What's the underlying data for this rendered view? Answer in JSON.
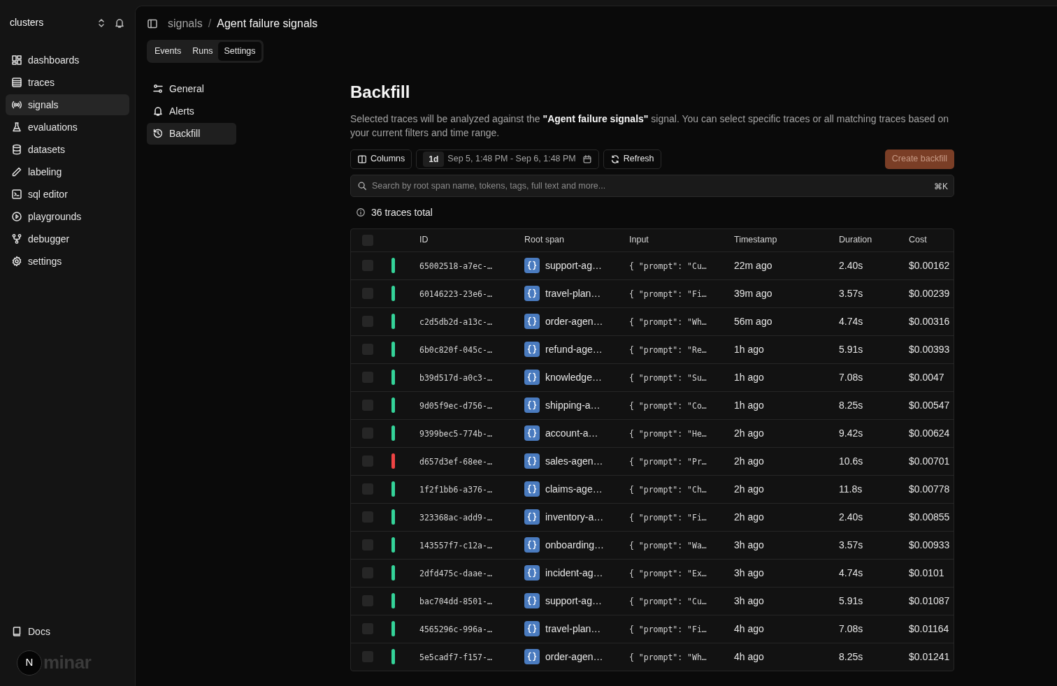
{
  "sidebar": {
    "workspace": "clusters",
    "items": [
      {
        "label": "dashboards",
        "selected": false
      },
      {
        "label": "traces",
        "selected": false
      },
      {
        "label": "signals",
        "selected": true
      },
      {
        "label": "evaluations",
        "selected": false
      },
      {
        "label": "datasets",
        "selected": false
      },
      {
        "label": "labeling",
        "selected": false
      },
      {
        "label": "sql editor",
        "selected": false
      },
      {
        "label": "playgrounds",
        "selected": false
      },
      {
        "label": "debugger",
        "selected": false
      },
      {
        "label": "settings",
        "selected": false
      }
    ],
    "docs": "Docs",
    "avatar": "N",
    "logo": "minar"
  },
  "breadcrumb": {
    "parent": "signals",
    "separator": "/",
    "current": "Agent failure signals"
  },
  "tabs": [
    {
      "label": "Events",
      "selected": false
    },
    {
      "label": "Runs",
      "selected": false
    },
    {
      "label": "Settings",
      "selected": true
    }
  ],
  "settings_nav": [
    {
      "label": "General",
      "selected": false
    },
    {
      "label": "Alerts",
      "selected": false
    },
    {
      "label": "Backfill",
      "selected": true
    }
  ],
  "title": "Backfill",
  "description": "Selected traces will be analyzed against the **\"Agent failure signals\"** signal. You can select specific traces or all matching traces based on your current filters and time range.",
  "toolbar": {
    "columns": "Columns",
    "range_badge": "1d",
    "range": "Sep 5, 1:48 PM - Sep 6, 1:48 PM",
    "refresh": "Refresh",
    "create": "Create backfill",
    "create_disabled": true
  },
  "search": {
    "placeholder": "Search by root span name, tokens, tags, full text and more...",
    "shortcut": "⌘K"
  },
  "total": "36 traces total",
  "table": {
    "all_checked": false,
    "columns": [
      "ID",
      "Root span",
      "Input",
      "Timestamp",
      "Duration",
      "Cost"
    ],
    "rows": [
      {
        "checked": false,
        "color": "#34d399",
        "id": "65002518-a7ec-…",
        "root_span": "support-ag…",
        "input": "{ \"prompt\": \"Cu…",
        "timestamp": "22m ago",
        "duration": "2.40s",
        "cost": "$0.00162"
      },
      {
        "checked": false,
        "color": "#34d399",
        "id": "60146223-23e6-…",
        "root_span": "travel-plan…",
        "input": "{ \"prompt\": \"Fi…",
        "timestamp": "39m ago",
        "duration": "3.57s",
        "cost": "$0.00239"
      },
      {
        "checked": false,
        "color": "#34d399",
        "id": "c2d5db2d-a13c-…",
        "root_span": "order-agen…",
        "input": "{ \"prompt\": \"Wh…",
        "timestamp": "56m ago",
        "duration": "4.74s",
        "cost": "$0.00316"
      },
      {
        "checked": false,
        "color": "#34d399",
        "id": "6b0c820f-045c-…",
        "root_span": "refund-age…",
        "input": "{ \"prompt\": \"Re…",
        "timestamp": "1h ago",
        "duration": "5.91s",
        "cost": "$0.00393"
      },
      {
        "checked": false,
        "color": "#34d399",
        "id": "b39d517d-a0c3-…",
        "root_span": "knowledge…",
        "input": "{ \"prompt\": \"Su…",
        "timestamp": "1h ago",
        "duration": "7.08s",
        "cost": "$0.0047"
      },
      {
        "checked": false,
        "color": "#34d399",
        "id": "9d05f9ec-d756-…",
        "root_span": "shipping-a…",
        "input": "{ \"prompt\": \"Co…",
        "timestamp": "1h ago",
        "duration": "8.25s",
        "cost": "$0.00547"
      },
      {
        "checked": false,
        "color": "#34d399",
        "id": "9399bec5-774b-…",
        "root_span": "account-a…",
        "input": "{ \"prompt\": \"He…",
        "timestamp": "2h ago",
        "duration": "9.42s",
        "cost": "$0.00624"
      },
      {
        "checked": false,
        "color": "#ef4444",
        "id": "d657d3ef-68ee-…",
        "root_span": "sales-agen…",
        "input": "{ \"prompt\": \"Pr…",
        "timestamp": "2h ago",
        "duration": "10.6s",
        "cost": "$0.00701"
      },
      {
        "checked": false,
        "color": "#34d399",
        "id": "1f2f1bb6-a376-…",
        "root_span": "claims-age…",
        "input": "{ \"prompt\": \"Ch…",
        "timestamp": "2h ago",
        "duration": "11.8s",
        "cost": "$0.00778"
      },
      {
        "checked": false,
        "color": "#34d399",
        "id": "323368ac-add9-…",
        "root_span": "inventory-a…",
        "input": "{ \"prompt\": \"Fi…",
        "timestamp": "2h ago",
        "duration": "2.40s",
        "cost": "$0.00855"
      },
      {
        "checked": false,
        "color": "#34d399",
        "id": "143557f7-c12a-…",
        "root_span": "onboarding…",
        "input": "{ \"prompt\": \"Wa…",
        "timestamp": "3h ago",
        "duration": "3.57s",
        "cost": "$0.00933"
      },
      {
        "checked": false,
        "color": "#34d399",
        "id": "2dfd475c-daae-…",
        "root_span": "incident-ag…",
        "input": "{ \"prompt\": \"Ex…",
        "timestamp": "3h ago",
        "duration": "4.74s",
        "cost": "$0.0101"
      },
      {
        "checked": false,
        "color": "#34d399",
        "id": "bac704dd-8501-…",
        "root_span": "support-ag…",
        "input": "{ \"prompt\": \"Cu…",
        "timestamp": "3h ago",
        "duration": "5.91s",
        "cost": "$0.01087"
      },
      {
        "checked": false,
        "color": "#34d399",
        "id": "4565296c-996a-…",
        "root_span": "travel-plan…",
        "input": "{ \"prompt\": \"Fi…",
        "timestamp": "4h ago",
        "duration": "7.08s",
        "cost": "$0.01164"
      },
      {
        "checked": false,
        "color": "#34d399",
        "id": "5e5cadf7-f157-…",
        "root_span": "order-agen…",
        "input": "{ \"prompt\": \"Wh…",
        "timestamp": "4h ago",
        "duration": "8.25s",
        "cost": "$0.01241"
      }
    ]
  }
}
